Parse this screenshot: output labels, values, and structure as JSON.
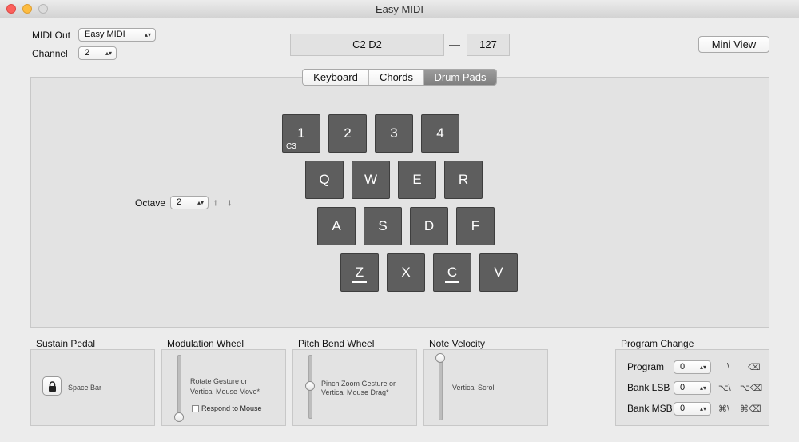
{
  "window": {
    "title": "Easy MIDI"
  },
  "header": {
    "midi_out_label": "MIDI Out",
    "midi_out_value": "Easy MIDI",
    "channel_label": "Channel",
    "channel_value": "2",
    "notes_display": "C2  D2",
    "dash": "—",
    "velocity_display": "127",
    "mini_view_label": "Mini View"
  },
  "tabs": [
    {
      "label": "Keyboard"
    },
    {
      "label": "Chords"
    },
    {
      "label": "Drum Pads",
      "selected": true
    }
  ],
  "drum": {
    "octave_label": "Octave",
    "octave_value": "2",
    "octave_arrows": "↑ ↓",
    "rows": [
      [
        {
          "key": "1",
          "note": "C3"
        },
        {
          "key": "2"
        },
        {
          "key": "3"
        },
        {
          "key": "4"
        }
      ],
      [
        {
          "key": "Q"
        },
        {
          "key": "W"
        },
        {
          "key": "E"
        },
        {
          "key": "R"
        }
      ],
      [
        {
          "key": "A"
        },
        {
          "key": "S"
        },
        {
          "key": "D"
        },
        {
          "key": "F"
        }
      ],
      [
        {
          "key": "Z",
          "underlined": true
        },
        {
          "key": "X"
        },
        {
          "key": "C",
          "underlined": true
        },
        {
          "key": "V"
        }
      ]
    ]
  },
  "sustain": {
    "title": "Sustain Pedal",
    "hint": "Space Bar",
    "icon": "lock-icon"
  },
  "modulation": {
    "title": "Modulation Wheel",
    "hint_line1": "Rotate Gesture or",
    "hint_line2": "Vertical Mouse Move*",
    "respond_label": "Respond to Mouse",
    "level": 0.0
  },
  "pitch_bend": {
    "title": "Pitch Bend Wheel",
    "hint_line1": "Pinch Zoom Gesture or",
    "hint_line2": "Vertical Mouse Drag*",
    "level": 0.5
  },
  "velocity": {
    "title": "Note Velocity",
    "hint": "Vertical Scroll",
    "level": 1.0
  },
  "program_change": {
    "title": "Program Change",
    "rows": [
      {
        "label": "Program",
        "value": "0",
        "key1": "\\",
        "key2": "⌫"
      },
      {
        "label": "Bank LSB",
        "value": "0",
        "key1": "⌥\\",
        "key2": "⌥⌫"
      },
      {
        "label": "Bank MSB",
        "value": "0",
        "key1": "⌘\\",
        "key2": "⌘⌫"
      }
    ]
  }
}
